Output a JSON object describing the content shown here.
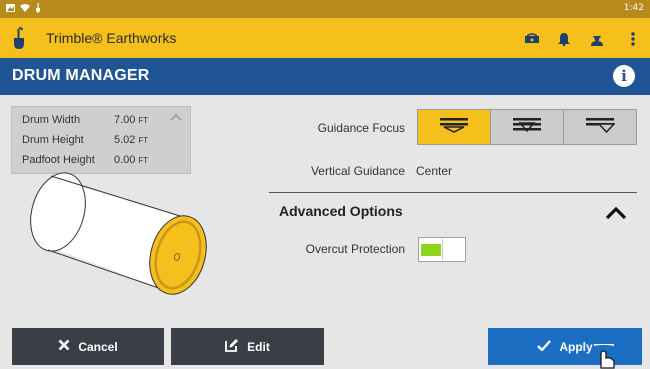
{
  "status_bar": {
    "time": "1:42",
    "icons": [
      "image-icon",
      "wifi-icon",
      "shovel-icon"
    ]
  },
  "app": {
    "title": "Trimble® Earthworks",
    "actions": [
      "tablet-icon",
      "bell-icon",
      "user-icon",
      "more-vert-icon"
    ]
  },
  "page": {
    "title": "DRUM MANAGER",
    "info_icon": "info-icon"
  },
  "dimensions": [
    {
      "label": "Drum Width",
      "value": "7.00",
      "unit": "FT"
    },
    {
      "label": "Drum Height",
      "value": "5.02",
      "unit": "FT"
    },
    {
      "label": "Padfoot Height",
      "value": "0.00",
      "unit": "FT"
    }
  ],
  "guidance": {
    "focus_label": "Guidance Focus",
    "focus_options": [
      "focus-top-icon",
      "focus-center-icon",
      "focus-bottom-icon"
    ],
    "focus_selected": 0,
    "vertical_label": "Vertical Guidance",
    "vertical_value": "Center"
  },
  "advanced": {
    "title": "Advanced Options",
    "overcut_label": "Overcut Protection",
    "overcut_on": true
  },
  "buttons": {
    "cancel": "Cancel",
    "edit": "Edit",
    "apply": "Apply"
  },
  "colors": {
    "accent": "#f5bf1c",
    "header": "#1f5594",
    "apply": "#1b6ec2",
    "toggle_on": "#8fd31b"
  }
}
